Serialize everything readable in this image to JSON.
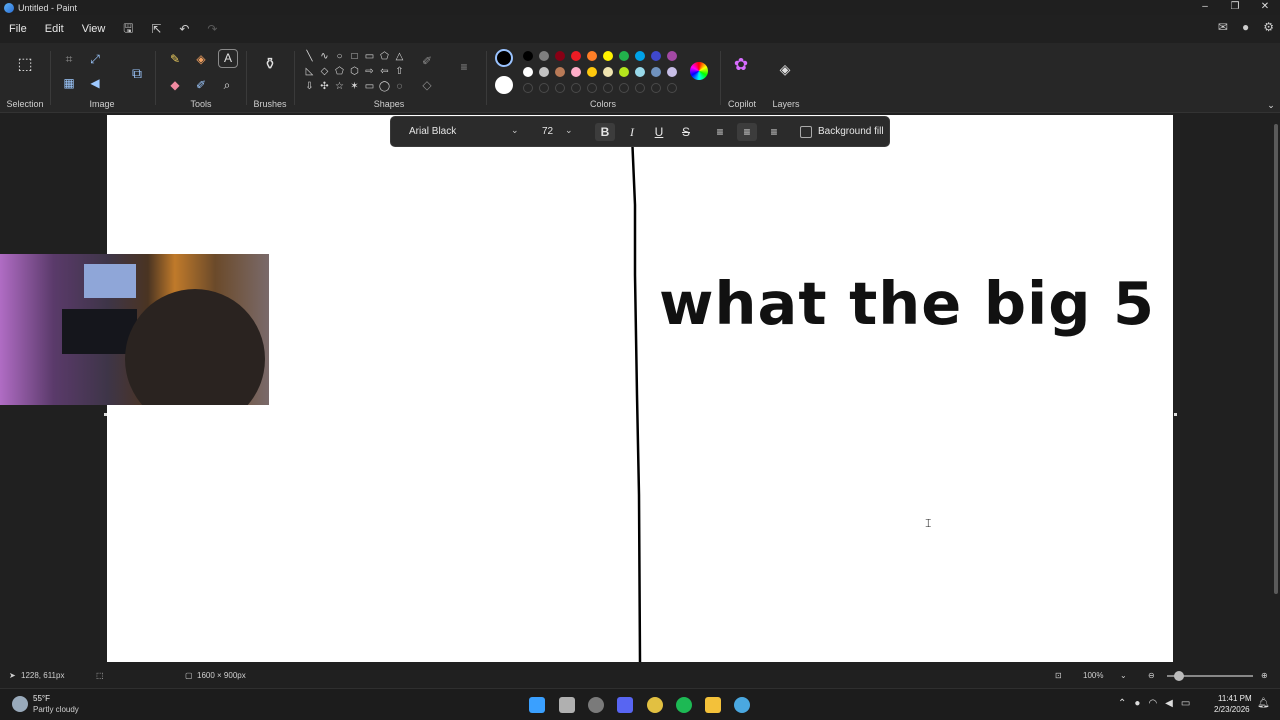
{
  "window": {
    "title": "Untitled - Paint",
    "controls": [
      "–",
      "❐",
      "✕"
    ]
  },
  "menu": {
    "items": [
      "File",
      "Edit",
      "View"
    ]
  },
  "ribbon": {
    "groups": {
      "selection": "Selection",
      "image": "Image",
      "tools": "Tools",
      "brushes": "Brushes",
      "shapes": "Shapes",
      "colors": "Colors",
      "copilot": "Copilot",
      "layers": "Layers"
    },
    "shape_glyphs": [
      "╲",
      "∿",
      "○",
      "□",
      "▭",
      "⬠",
      "△",
      "◺",
      "◇",
      "⬠",
      "⬡",
      "⇨",
      "⇦",
      "⇧",
      "⇩",
      "✣",
      "☆",
      "✶",
      "▭",
      "◯",
      "◌"
    ],
    "palette_row1": [
      "#000000",
      "#7f7f7f",
      "#880015",
      "#ed1c24",
      "#ff7f27",
      "#fff200",
      "#22b14c",
      "#00a2e8",
      "#3f48cc",
      "#a349a4"
    ],
    "palette_row2": [
      "#ffffff",
      "#c3c3c3",
      "#b97a57",
      "#ffaec9",
      "#ffc90e",
      "#efe4b0",
      "#b5e61d",
      "#99d9ea",
      "#7092be",
      "#c8bfe7"
    ],
    "primary_color": "#000000",
    "secondary_color": "#ffffff"
  },
  "text_toolbar": {
    "font": "Arial Black",
    "size": "72",
    "bold": "B",
    "italic": "I",
    "underline": "U",
    "strike": "S",
    "background_fill": "Background fill"
  },
  "canvas": {
    "text": "what the big 5"
  },
  "status": {
    "cursor_pos": "1228, 611px",
    "canvas_size": "1600 × 900px",
    "zoom": "100%"
  },
  "taskbar": {
    "weather_temp": "55°F",
    "weather_desc": "Partly cloudy",
    "time": "11:41 PM",
    "date": "2/23/2026"
  }
}
